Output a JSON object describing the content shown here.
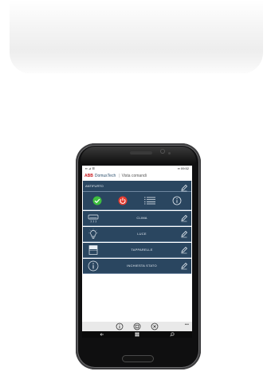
{
  "statusbar": {
    "left": "▪▪ ⊿ ☰",
    "right": "▪▪ 09:52"
  },
  "appbar": {
    "brand": "ABB",
    "app_name": "DomusTech",
    "page_title": "Vista comandi"
  },
  "antifurto": {
    "title": "ANTIFURTO"
  },
  "rows": [
    {
      "label": "CLIMA",
      "icon": "air-conditioner-icon"
    },
    {
      "label": "LUCE",
      "icon": "light-bulb-icon"
    },
    {
      "label": "TAPPARELLE",
      "icon": "shutter-icon"
    },
    {
      "label": "INCHIESTA STATO",
      "icon": "info-icon"
    }
  ],
  "colors": {
    "tile": "#2a4660",
    "divider": "#6f87a0",
    "ok": "#3fbf3f",
    "power": "#e53a2e",
    "brand": "#c8151b"
  }
}
